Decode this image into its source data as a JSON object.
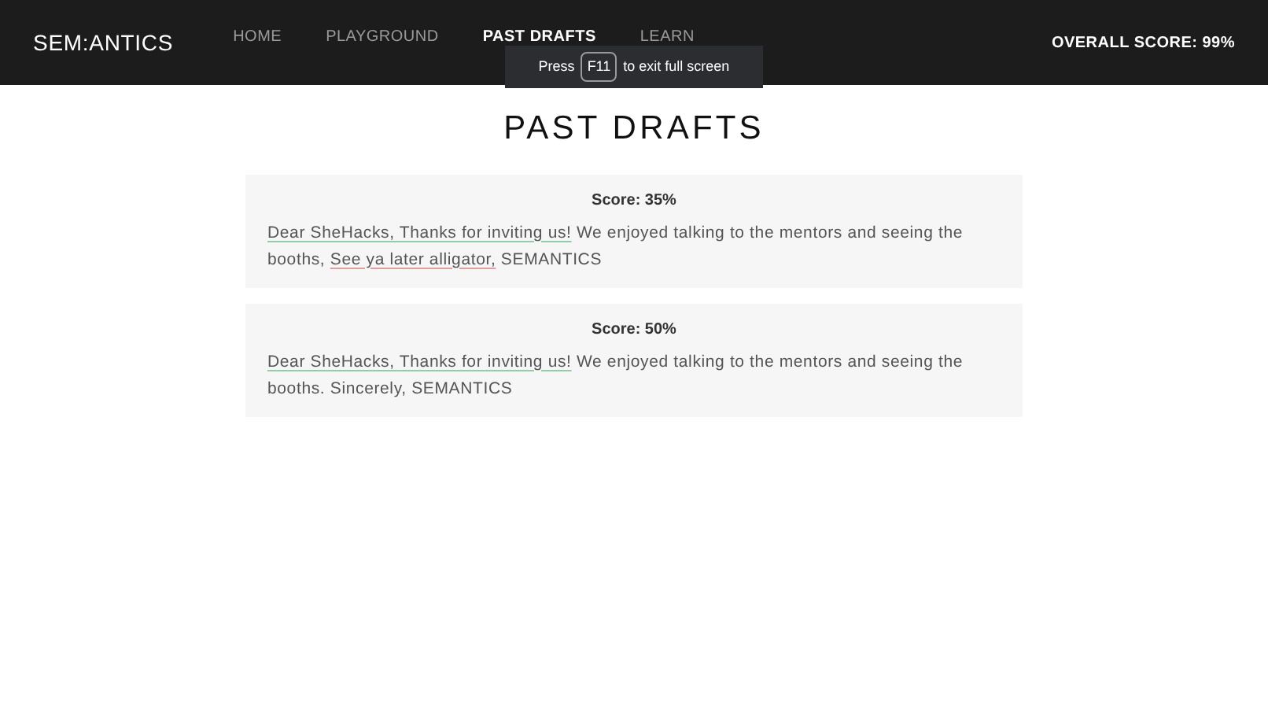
{
  "header": {
    "logo": "SEM:ANTICS",
    "nav": [
      {
        "label": "HOME",
        "selected": false
      },
      {
        "label": "PLAYGROUND",
        "selected": false
      },
      {
        "label": "PAST DRAFTS",
        "selected": true
      },
      {
        "label": "LEARN",
        "selected": false
      }
    ],
    "score": "OVERALL SCORE: 99%"
  },
  "fullscreen_notice": {
    "before": "Press",
    "key": "F11",
    "after": "to exit full screen"
  },
  "title": "PAST DRAFTS",
  "drafts": [
    {
      "score": "Score: 35%",
      "segments": [
        {
          "kind": "highlight",
          "text": "Dear SheHacks, Thanks for inviting us!",
          "color": "#8fcfa8"
        },
        {
          "kind": "plain",
          "text": " We enjoyed talking to the mentors and seeing the booths, "
        },
        {
          "kind": "highlight",
          "text": "See ya later alligator,",
          "color": "#e0a0a0"
        },
        {
          "kind": "plain",
          "text": " SEMANTICS"
        }
      ]
    },
    {
      "score": "Score: 50%",
      "segments": [
        {
          "kind": "highlight",
          "text": "Dear SheHacks, Thanks for inviting us!",
          "color": "#8fcfa8"
        },
        {
          "kind": "plain",
          "text": " We enjoyed talking to the mentors and seeing the booths. Sincerely, SEMANTICS"
        }
      ]
    }
  ]
}
